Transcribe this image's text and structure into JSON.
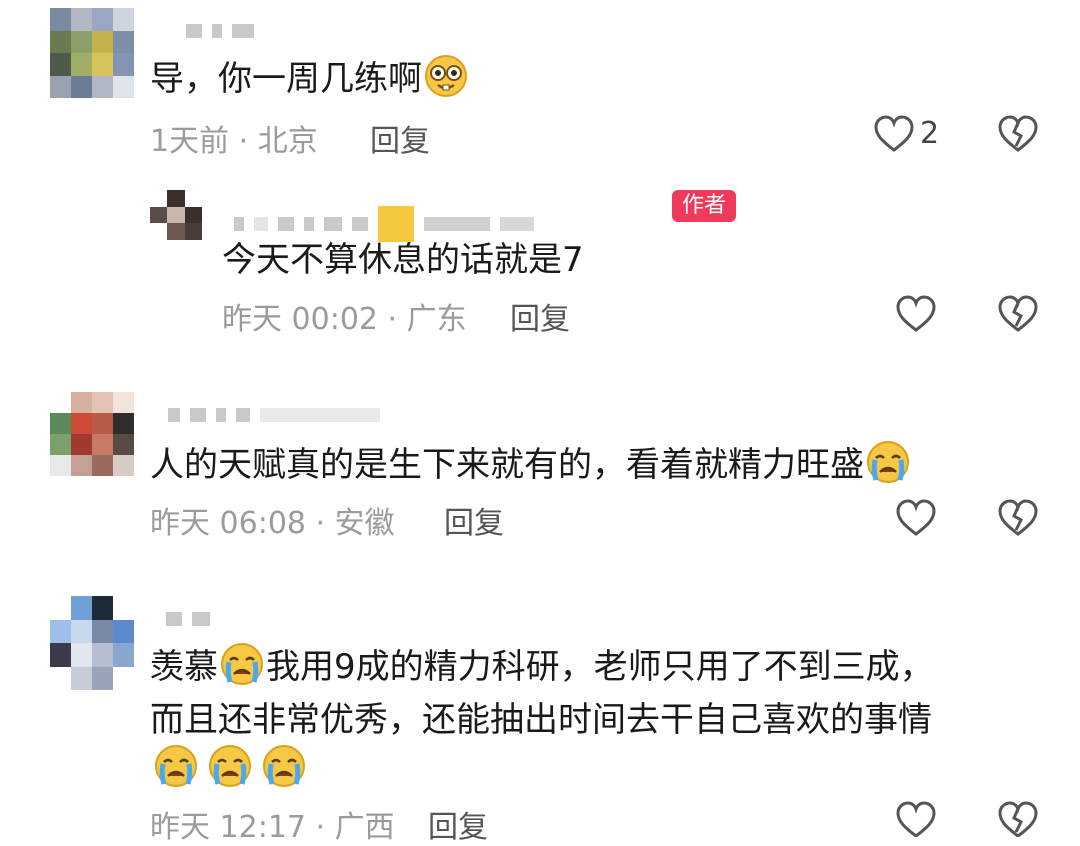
{
  "comments": [
    {
      "text": "导，你一周几练啊",
      "emoji": "nerd-emoji",
      "meta": "1天前 · 北京",
      "reply_label": "回复",
      "like_count": "2",
      "reply": {
        "badge": "作者",
        "text": "今天不算休息的话就是7",
        "meta": "昨天 00:02 · 广东",
        "reply_label": "回复"
      }
    },
    {
      "text": "人的天赋真的是生下来就有的，看着就精力旺盛",
      "emoji": "crying-emoji",
      "meta": "昨天 06:08 · 安徽",
      "reply_label": "回复"
    },
    {
      "text_line1_a": "羡慕",
      "text_line1_b": "我用9成的精力科研，老师只用了不到三成，",
      "text_line2": "而且还非常优秀，还能抽出时间去干自己喜欢的事情",
      "emoji": "crying-emoji",
      "meta": "昨天 12:17 · 广西",
      "reply_label": "回复"
    }
  ],
  "colors": {
    "meta": "#9b9b9b",
    "badge": "#f03a5b",
    "icon": "#555555"
  }
}
